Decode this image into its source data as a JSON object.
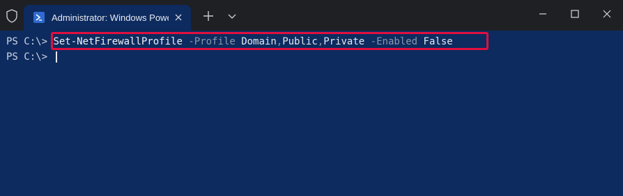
{
  "titlebar": {
    "tab_title": "Administrator: Windows PowerShell",
    "icons": {
      "shield": "shield-icon",
      "tab": "powershell-icon",
      "tab_close": "close-icon",
      "new_tab": "plus-icon",
      "dropdown": "chevron-down-icon",
      "minimize": "minimize-icon",
      "maximize": "maximize-icon",
      "close": "close-icon"
    }
  },
  "terminal": {
    "line1": {
      "prompt": "PS C:\\> ",
      "command": "Set-NetFirewallProfile",
      "param1": "-Profile",
      "arg1a": "Domain",
      "comma1": ",",
      "arg1b": "Public",
      "comma2": ",",
      "arg1c": "Private",
      "param2": "-Enabled",
      "arg2": "False"
    },
    "line2": {
      "prompt": "PS C:\\> "
    }
  },
  "colors": {
    "titlebar_bg": "#1f2024",
    "terminal_bg": "#0d2b5f",
    "highlight_border": "#e0103f"
  }
}
